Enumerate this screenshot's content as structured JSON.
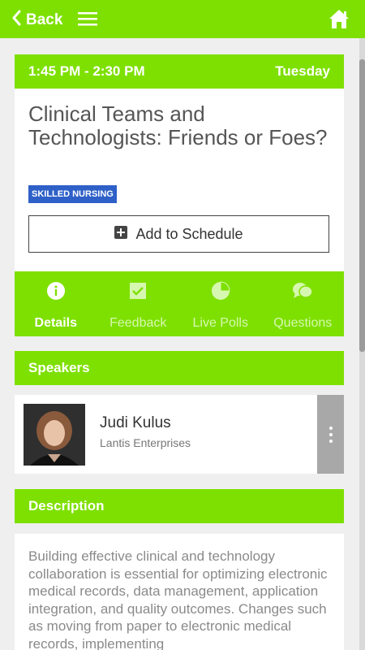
{
  "nav": {
    "back_label": "Back"
  },
  "session": {
    "time": "1:45 PM - 2:30 PM",
    "day": "Tuesday",
    "title": "Clinical Teams and Technologists: Friends or Foes?",
    "track_badge": "SKILLED NURSING",
    "add_button_label": "Add to Schedule"
  },
  "tabs": [
    {
      "label": "Details",
      "icon": "info-icon",
      "active": true
    },
    {
      "label": "Feedback",
      "icon": "checkbox-icon",
      "active": false
    },
    {
      "label": "Live Polls",
      "icon": "pie-chart-icon",
      "active": false
    },
    {
      "label": "Questions",
      "icon": "chat-bubbles-icon",
      "active": false
    }
  ],
  "speakers": {
    "header": "Speakers",
    "items": [
      {
        "name": "Judi Kulus",
        "organization": "Lantis Enterprises"
      }
    ]
  },
  "description": {
    "header": "Description",
    "text": "Building effective clinical and technology collaboration is essential for optimizing electronic medical records, data management, application integration, and quality outcomes. Changes such as moving from paper to electronic medical records, implementing"
  },
  "colors": {
    "accent": "#7ee000",
    "badge": "#2e60c8"
  }
}
